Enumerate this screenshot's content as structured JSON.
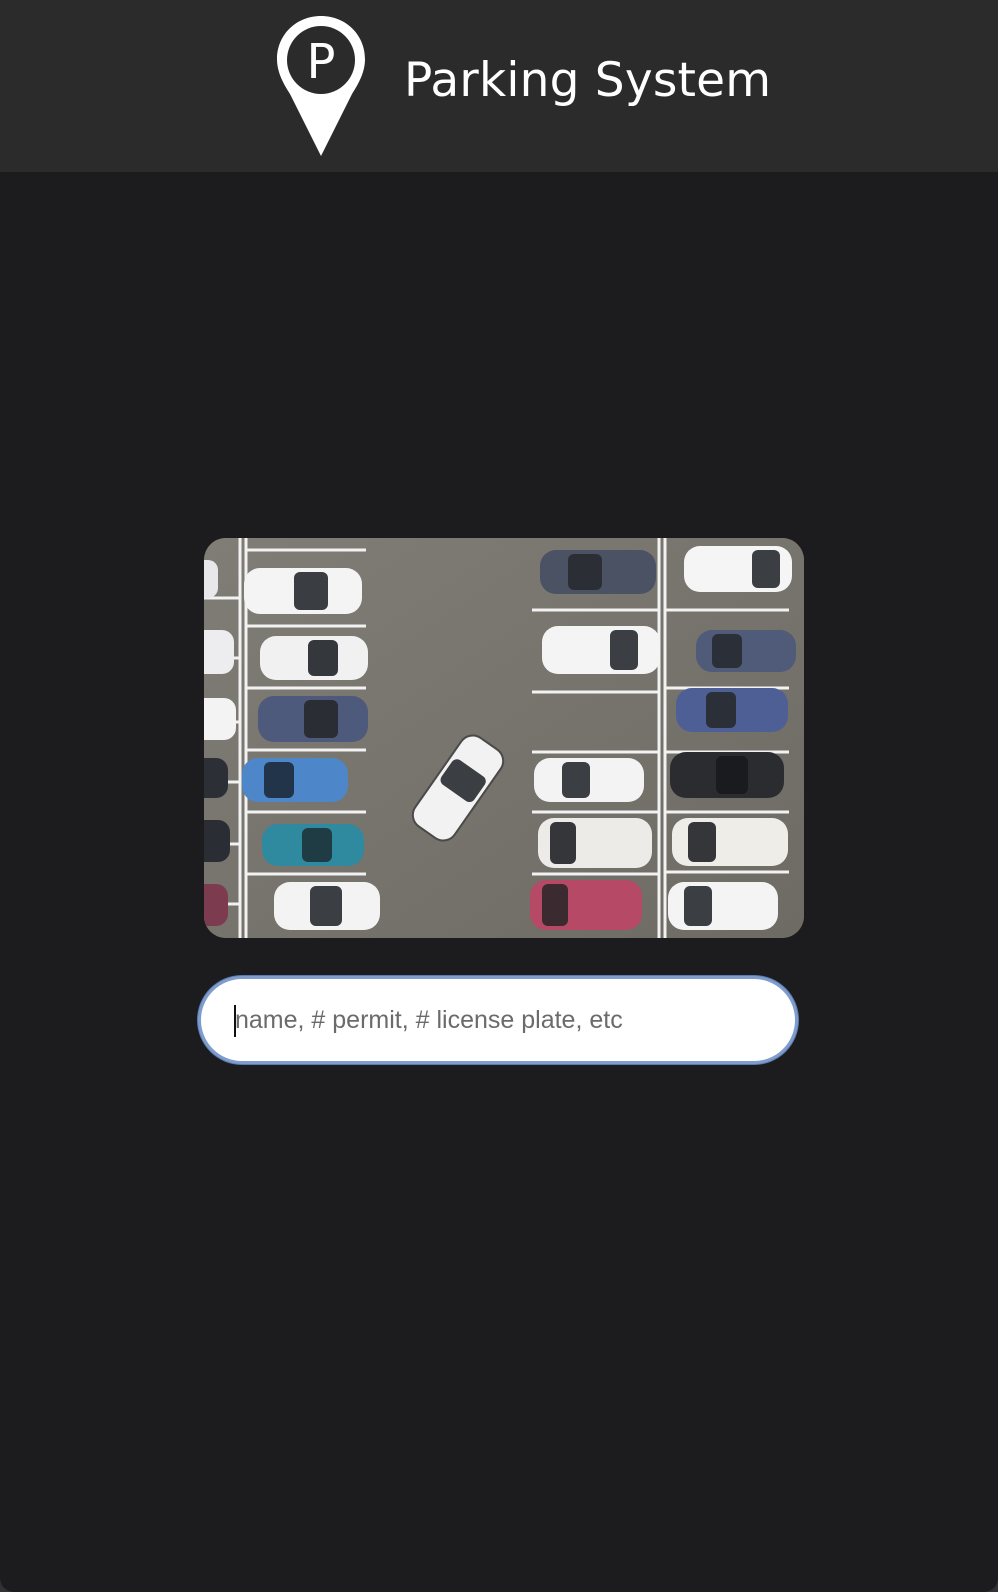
{
  "header": {
    "logo_letter": "P",
    "title": "Parking System"
  },
  "hero": {
    "image_alt": "Aerial view of parked cars"
  },
  "search": {
    "placeholder": "name, # permit, # license plate, etc",
    "value": ""
  },
  "colors": {
    "page_background": "#1c1c1e",
    "header_background": "#2b2b2b",
    "title_color": "#ffffff",
    "search_border": "#7f9ccc"
  },
  "icons": {
    "logo": "parking-location-pin-icon"
  }
}
